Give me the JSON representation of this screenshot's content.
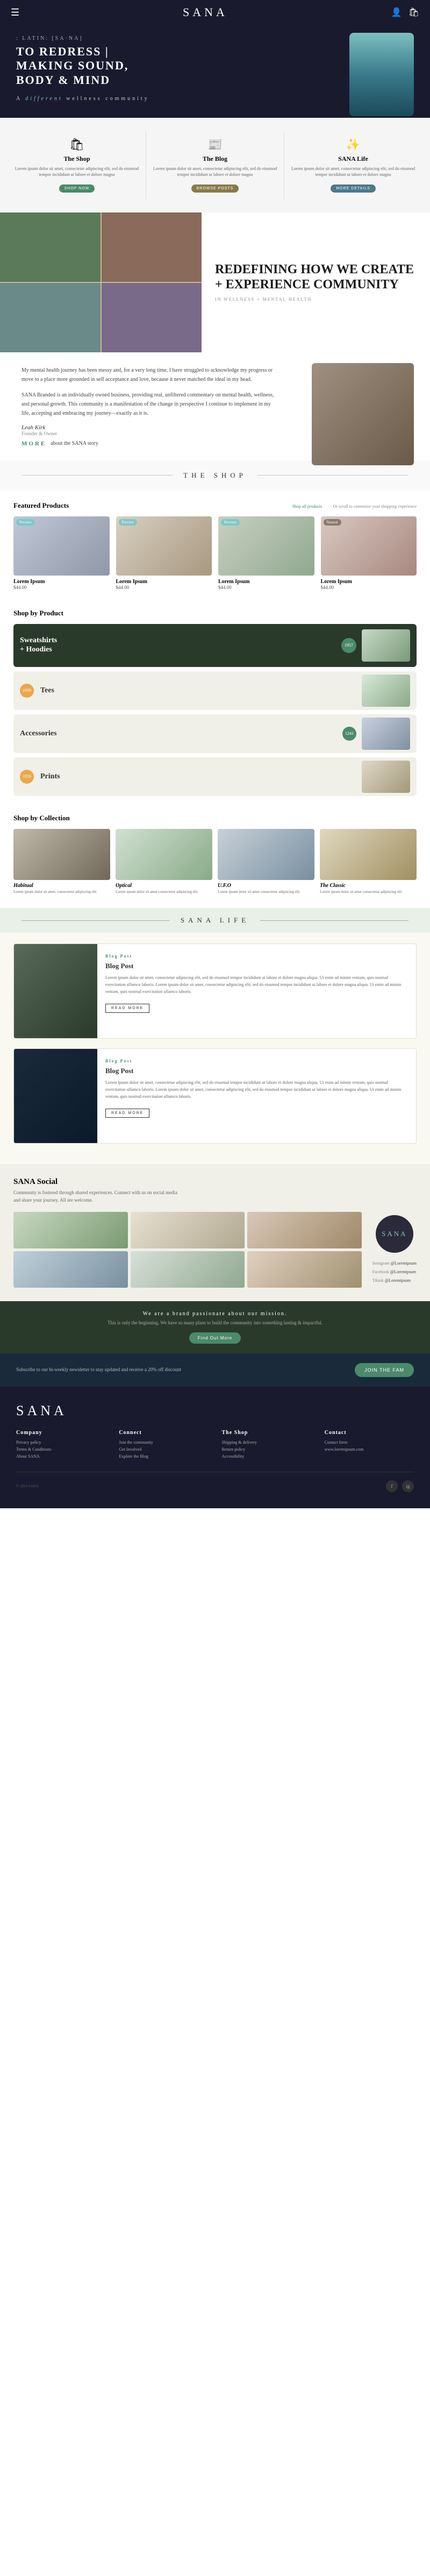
{
  "nav": {
    "logo": "SANA",
    "menu_icon": "☰",
    "user_icon": "👤",
    "bag_icon": "🛍"
  },
  "hero": {
    "latin": ": LATIN:  [SA·NA]",
    "tagline": "TO REDRESS |\nMAKING SOUND,\nBODY & MIND",
    "subtitle_prefix": "A ",
    "subtitle_italic": "different",
    "subtitle_suffix": " wellness community"
  },
  "cards": [
    {
      "icon": "🛍",
      "title": "The Shop",
      "text": "Lorem ipsum dolor sit amet, consectetur adipiscing elit, sed do eiusmod tempor incididunt ut labore et dolore magna",
      "btn": "SHOP NOW",
      "btn_class": "btn-green"
    },
    {
      "icon": "📰",
      "title": "The Blog",
      "text": "Lorem ipsum dolor sit amet, consectetur adipiscing elit, sed do eiusmod tempor incididunt ut labore et dolore magna",
      "btn": "BROWSE POSTS",
      "btn_class": "btn-olive"
    },
    {
      "icon": "✨",
      "title": "SANA Life",
      "text": "Lorem ipsum dolor sit amet, consectetur adipiscing elit, sed do eiusmod tempor incididunt ut labore et dolore magna",
      "btn": "MORE DETAILS",
      "btn_class": "btn-teal"
    }
  ],
  "story": {
    "heading": "REDEFINING HOW WE CREATE + EXPERIENCE COMMUNITY",
    "sub": "IN WELLNESS + MENTAL HEALTH",
    "paragraphs": [
      "My mental health journey has been messy and, for a very long time, I have struggled to acknowledge my progress or move to a place more grounded in self acceptance and love, because it never matched the ideal in my head.",
      "SANA Branded is an individually owned business, providing real, unfiltered commentary on mental health, wellness, and personal growth. This community is a manifestation of the change in perspective I continue to implement in my life, accepting and embracing my journey—exactly as it is."
    ],
    "author": "Leah Kirk",
    "author_role": "Founder & Owner",
    "more_label": "MORE",
    "more_text": "about the SANA story"
  },
  "shop_section": {
    "title": "THE SHOP",
    "featured_title": "Featured Products",
    "all_link": "Shop all products",
    "customize": "Or scroll to customize your shopping experience",
    "products": [
      {
        "name": "Lorem Ipsum",
        "price": "$44.00",
        "badge": "Preview",
        "badge_class": "product-badge",
        "img_class": "product-img-1"
      },
      {
        "name": "Lorem Ipsum",
        "price": "$44.00",
        "badge": "Preview",
        "badge_class": "product-badge",
        "img_class": "product-img-2"
      },
      {
        "name": "Lorem Ipsum",
        "price": "$44.00",
        "badge": "Preview",
        "badge_class": "product-badge",
        "img_class": "product-img-3"
      },
      {
        "name": "Lorem Ipsum",
        "price": "$44.00",
        "badge": "Natural",
        "badge_class": "product-badge product-badge-natural",
        "img_class": "product-img-4"
      }
    ],
    "by_product_title": "Shop by Product",
    "categories": [
      {
        "label": "Sweatshirts\n+ Hoodies",
        "count": "1957",
        "dark": true
      },
      {
        "label": "Tees",
        "count": "1959",
        "dark": false
      },
      {
        "label": "Accessories",
        "count": "1241",
        "dark": false
      },
      {
        "label": "Prints",
        "count": "1959",
        "dark": false
      }
    ],
    "by_collection_title": "Shop by Collection",
    "collections": [
      {
        "name": "Habitual",
        "desc": "Lorem ipsum dolor sit amet, consectetur adipiscing elit",
        "img_class": "coll-1"
      },
      {
        "name": "Optical",
        "desc": "Lorem ipsum dolor sit amet consectetur adipiscing elit",
        "img_class": "coll-2"
      },
      {
        "name": "U.F.O",
        "desc": "Lorem ipsum dolor sit amet consectetur adipiscing elit",
        "img_class": "coll-3"
      },
      {
        "name": "The Classic",
        "desc": "Lorem ipsum dolor sit amet consectetur adipiscing elit",
        "img_class": "coll-4"
      }
    ]
  },
  "sana_life": {
    "title": "SANA LIFE",
    "blog_posts": [
      {
        "tag": "Blog Post",
        "title": "Blog Post",
        "text": "Lorem ipsum dolor sit amet, consectetur adipiscing elit, sed do eiusmod tempor incididunt ut labore et dolore magna aliqua. Ut enim ad minim veniam, quis nostrud exercitation ullamco laboris. Lorem ipsum dolor sit amet, consectetur adipiscing elit, sed do eiusmod tempor incididunt ut labore et dolore magna aliqua. Ut enim ad minim veniam, quis nostrud exercitation ullamco laboris.",
        "read_more": "READ MORE",
        "img_class": "blog-img-1"
      },
      {
        "tag": "Blog Post",
        "title": "Blog Post",
        "text": "Lorem ipsum dolor sit amet, consectetur adipiscing elit, sed do eiusmod tempor incididunt ut labore et dolore magna aliqua. Ut enim ad minim veniam, quis nostrud exercitation ullamco laboris. Lorem ipsum dolor sit amet, consectetur adipiscing elit, sed do eiusmod tempor incididunt ut labore et dolore magna aliqua. Ut enim ad minim veniam, quis nostrud exercitation ullamco laboris.",
        "read_more": "READ MORE",
        "img_class": "blog-img-2"
      }
    ]
  },
  "social": {
    "title": "SANA Social",
    "desc": "Community is fostered through shared experiences. Connect with us on social media and share your journey. All are welcome.",
    "logo_text": "SANA",
    "links": [
      {
        "platform": "Instagram",
        "handle": "@Loremipsum"
      },
      {
        "platform": "Facebook",
        "handle": "@Loremipsum"
      },
      {
        "platform": "Tiktok",
        "handle": "@Loremipsum"
      }
    ]
  },
  "mission": {
    "text": "We are a brand passionate about our mission.",
    "subtext": "This is only the beginning. We have so many plans to build the community into something lasting & impactful.",
    "btn": "Find Out More"
  },
  "newsletter": {
    "text": "Subscribe to our bi-weekly newsletter to stay updated and receive a 20% off discount",
    "btn": "JOIN THE FAM"
  },
  "footer": {
    "logo": "SANA",
    "columns": [
      {
        "title": "Company",
        "links": [
          "Privacy policy",
          "Terms & Conditions",
          "About SANA"
        ]
      },
      {
        "title": "Connect",
        "links": [
          "Join the community",
          "Get Involved",
          "Explore the Blog"
        ]
      },
      {
        "title": "The Shop",
        "links": [
          "Shipping & delivery",
          "Return policy",
          "Accessibility"
        ]
      },
      {
        "title": "Contact",
        "links": [
          "Contact form",
          "www.loremipsum.com"
        ]
      }
    ]
  }
}
